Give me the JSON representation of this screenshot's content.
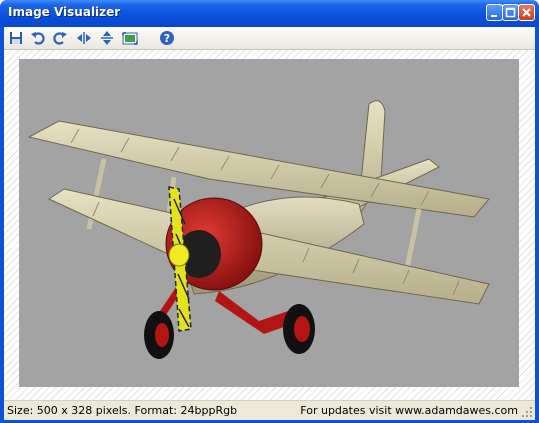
{
  "window": {
    "title": "Image Visualizer"
  },
  "toolbar": {
    "buttons": [
      {
        "icon": "save-icon"
      },
      {
        "icon": "rotate-left-icon"
      },
      {
        "icon": "rotate-right-icon"
      },
      {
        "icon": "flip-horizontal-icon"
      },
      {
        "icon": "flip-vertical-icon"
      },
      {
        "icon": "fit-to-window-icon"
      },
      {
        "icon": "help-icon"
      }
    ]
  },
  "image": {
    "subject": "biplane-render",
    "background_color": "#a3a3a3"
  },
  "status": {
    "info": "Size: 500 x 328 pixels. Format: 24bppRgb",
    "link": "For updates visit www.adamdawes.com"
  },
  "colors": {
    "titlebar": "#0a50db",
    "client": "#ece9d8"
  }
}
